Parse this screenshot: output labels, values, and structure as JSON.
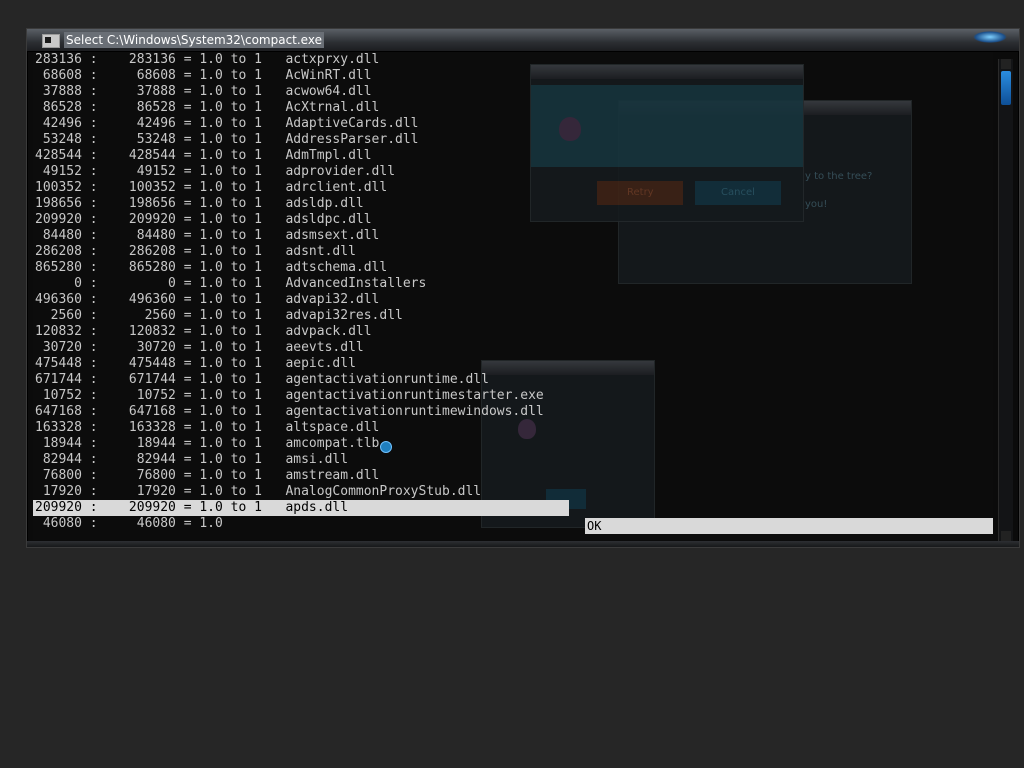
{
  "window": {
    "title": "Select C:\\Windows\\System32\\compact.exe"
  },
  "rows": [
    "283136 :    283136 = 1.0 to 1   actxprxy.dll",
    " 68608 :     68608 = 1.0 to 1   AcWinRT.dll",
    " 37888 :     37888 = 1.0 to 1   acwow64.dll",
    " 86528 :     86528 = 1.0 to 1   AcXtrnal.dll",
    " 42496 :     42496 = 1.0 to 1   AdaptiveCards.dll",
    " 53248 :     53248 = 1.0 to 1   AddressParser.dll",
    "428544 :    428544 = 1.0 to 1   AdmTmpl.dll",
    " 49152 :     49152 = 1.0 to 1   adprovider.dll",
    "100352 :    100352 = 1.0 to 1   adrclient.dll",
    "198656 :    198656 = 1.0 to 1   adsldp.dll",
    "209920 :    209920 = 1.0 to 1   adsldpc.dll",
    " 84480 :     84480 = 1.0 to 1   adsmsext.dll",
    "286208 :    286208 = 1.0 to 1   adsnt.dll",
    "865280 :    865280 = 1.0 to 1   adtschema.dll",
    "     0 :         0 = 1.0 to 1   AdvancedInstallers",
    "496360 :    496360 = 1.0 to 1   advapi32.dll",
    "  2560 :      2560 = 1.0 to 1   advapi32res.dll",
    "120832 :    120832 = 1.0 to 1   advpack.dll",
    " 30720 :     30720 = 1.0 to 1   aeevts.dll",
    "475448 :    475448 = 1.0 to 1   aepic.dll",
    "671744 :    671744 = 1.0 to 1   agentactivationruntime.dll",
    " 10752 :     10752 = 1.0 to 1   agentactivationruntimestarter.exe",
    "647168 :    647168 = 1.0 to 1   agentactivationruntimewindows.dll",
    "163328 :    163328 = 1.0 to 1   altspace.dll",
    " 18944 :     18944 = 1.0 to 1   amcompat.tlb",
    " 82944 :     82944 = 1.0 to 1   amsi.dll",
    " 76800 :     76800 = 1.0 to 1   amstream.dll",
    " 17920 :     17920 = 1.0 to 1   AnalogCommonProxyStub.dll"
  ],
  "highlighted_row": "209920 :    209920 = 1.0 to 1   apds.dll",
  "partial_row": " 46080 :     46080 = 1.0",
  "selection_bar_text": "OK",
  "ghost_dialog": {
    "retry_label": "Retry",
    "cancel_label": "Cancel"
  }
}
